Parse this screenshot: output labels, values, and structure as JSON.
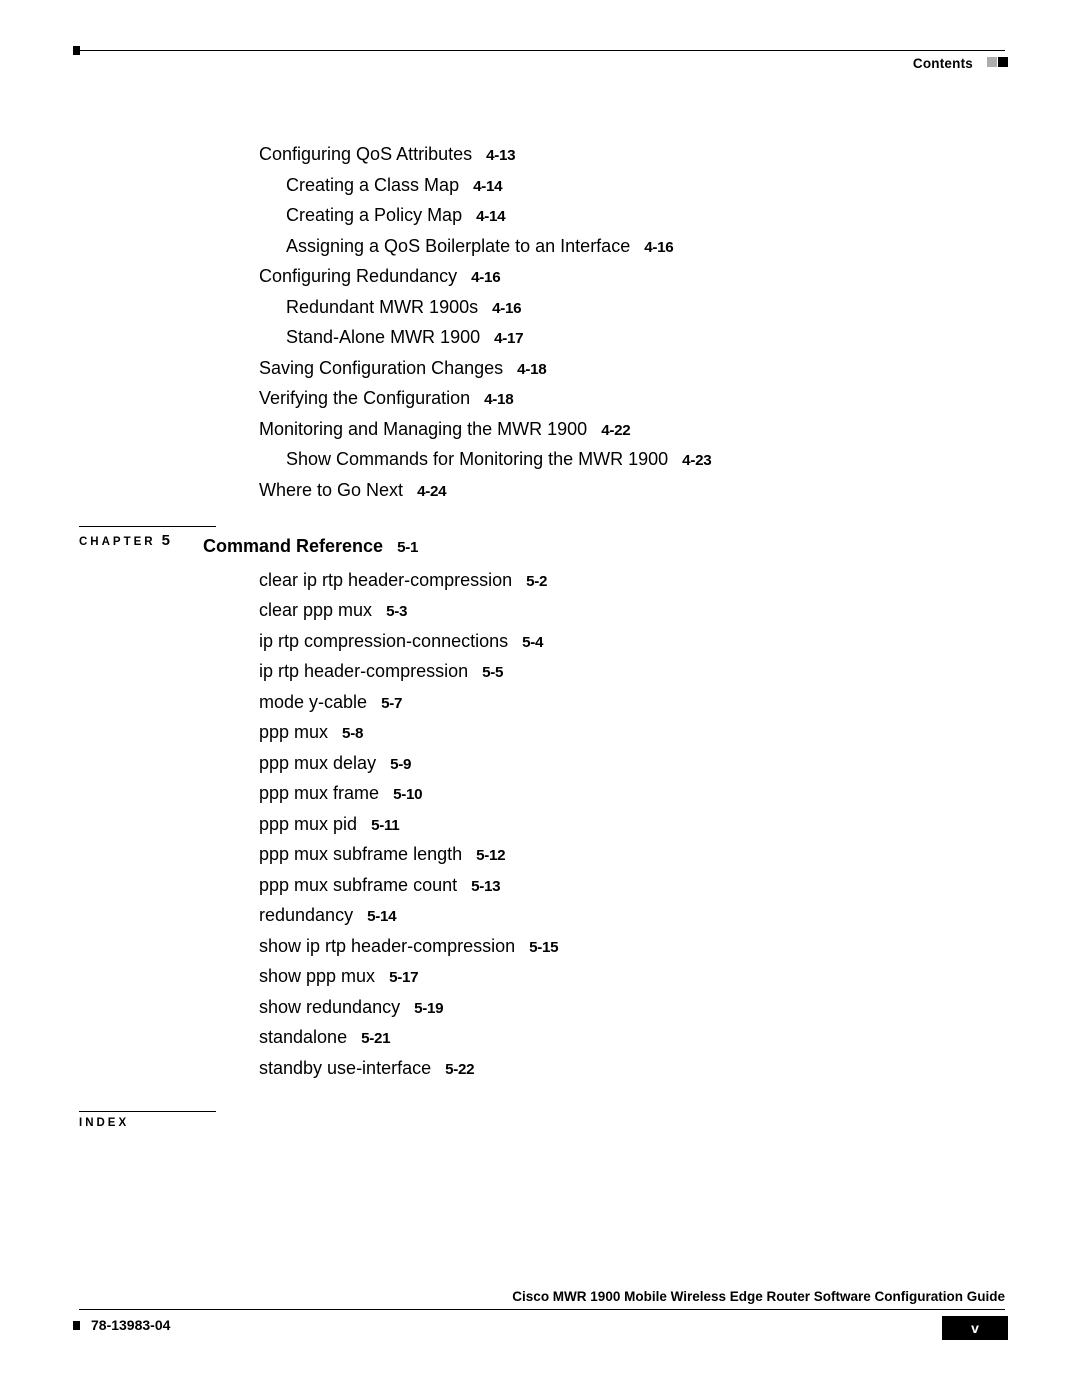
{
  "header": {
    "label": "Contents"
  },
  "toc_part1": [
    {
      "text": "Configuring QoS Attributes",
      "ref": "4-13",
      "indent": 0
    },
    {
      "text": "Creating a Class Map",
      "ref": "4-14",
      "indent": 1
    },
    {
      "text": "Creating a Policy Map",
      "ref": "4-14",
      "indent": 1
    },
    {
      "text": "Assigning a QoS Boilerplate to an Interface",
      "ref": "4-16",
      "indent": 1
    },
    {
      "text": "Configuring Redundancy",
      "ref": "4-16",
      "indent": 0
    },
    {
      "text": "Redundant MWR 1900s",
      "ref": "4-16",
      "indent": 1
    },
    {
      "text": "Stand-Alone MWR 1900",
      "ref": "4-17",
      "indent": 1
    },
    {
      "text": "Saving Configuration Changes",
      "ref": "4-18",
      "indent": 0
    },
    {
      "text": "Verifying the Configuration",
      "ref": "4-18",
      "indent": 0
    },
    {
      "text": "Monitoring and Managing the MWR 1900",
      "ref": "4-22",
      "indent": 0
    },
    {
      "text": "Show Commands for Monitoring the MWR 1900",
      "ref": "4-23",
      "indent": 1
    },
    {
      "text": "Where to Go Next",
      "ref": "4-24",
      "indent": 0
    }
  ],
  "chapter": {
    "label": "CHAPTER",
    "number": "5",
    "title": "Command Reference",
    "title_ref": "5-1",
    "items": [
      {
        "text": "clear ip rtp header-compression",
        "ref": "5-2"
      },
      {
        "text": "clear ppp mux",
        "ref": "5-3"
      },
      {
        "text": "ip rtp compression-connections",
        "ref": "5-4"
      },
      {
        "text": "ip rtp header-compression",
        "ref": "5-5"
      },
      {
        "text": "mode y-cable",
        "ref": "5-7"
      },
      {
        "text": "ppp mux",
        "ref": "5-8"
      },
      {
        "text": "ppp mux delay",
        "ref": "5-9"
      },
      {
        "text": "ppp mux frame",
        "ref": "5-10"
      },
      {
        "text": "ppp mux pid",
        "ref": "5-11"
      },
      {
        "text": "ppp mux subframe length",
        "ref": "5-12"
      },
      {
        "text": "ppp mux subframe count",
        "ref": "5-13"
      },
      {
        "text": "redundancy",
        "ref": "5-14"
      },
      {
        "text": "show ip rtp header-compression",
        "ref": "5-15"
      },
      {
        "text": "show ppp mux",
        "ref": "5-17"
      },
      {
        "text": "show redundancy",
        "ref": "5-19"
      },
      {
        "text": "standalone",
        "ref": "5-21"
      },
      {
        "text": "standby use-interface",
        "ref": "5-22"
      }
    ]
  },
  "index": {
    "label": "INDEX"
  },
  "footer": {
    "title": "Cisco MWR 1900 Mobile Wireless Edge Router Software Configuration Guide",
    "doc_number": "78-13983-04",
    "page": "v"
  }
}
